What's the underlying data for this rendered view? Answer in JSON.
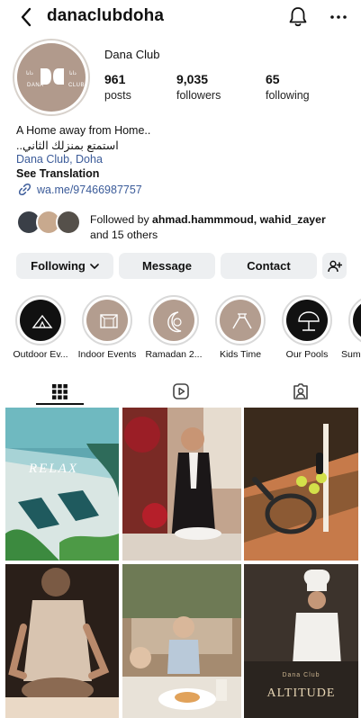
{
  "header": {
    "username": "danaclubdoha"
  },
  "avatar": {
    "text_left": "دانا",
    "text_right": "دانا",
    "text_bottom_left": "DANA",
    "text_bottom_right": "CLUB"
  },
  "profile": {
    "display_name": "Dana Club",
    "stats": [
      {
        "value": "961",
        "label": "posts"
      },
      {
        "value": "9,035",
        "label": "followers"
      },
      {
        "value": "65",
        "label": "following"
      }
    ],
    "bio_line1": "A Home away from Home..",
    "bio_line2": "استمتع بمنزلك الثاني..",
    "location": "Dana Club, Doha",
    "see_translation": "See Translation",
    "link": "wa.me/97466987757"
  },
  "followed_by": {
    "prefix": "Followed by ",
    "names": "ahmad.hammmoud, wahid_zayer",
    "suffix": "and 15 others"
  },
  "actions": {
    "following": "Following",
    "message": "Message",
    "contact": "Contact"
  },
  "highlights": [
    {
      "label": "Outdoor Ev...",
      "color": "#111111"
    },
    {
      "label": "Indoor Events",
      "color": "#b39d8f"
    },
    {
      "label": "Ramadan 2...",
      "color": "#b39d8f"
    },
    {
      "label": "Kids Time",
      "color": "#b39d8f"
    },
    {
      "label": "Our Pools",
      "color": "#111111"
    },
    {
      "label": "Sum",
      "color": "#111111"
    }
  ],
  "posts": [
    {
      "caption": "RELAX",
      "palette": [
        "#5fa7b0",
        "#a7d3d6",
        "#2e6b5a"
      ]
    },
    {
      "caption": "",
      "palette": [
        "#3b1f1a",
        "#8a1d22",
        "#c2a48e"
      ]
    },
    {
      "caption": "",
      "palette": [
        "#3a2a1c",
        "#8c5a34",
        "#c67a4a"
      ]
    },
    {
      "caption": "",
      "palette": [
        "#2a1f19",
        "#8b6a52",
        "#d8c4b0"
      ]
    },
    {
      "caption": "",
      "palette": [
        "#5a4a3a",
        "#a58b70",
        "#d9c8b4"
      ]
    },
    {
      "caption": "ALTITUDE",
      "palette": [
        "#1e1a17",
        "#3c332c",
        "#c9b28e"
      ]
    }
  ],
  "post_subtitle": "Dana Club",
  "colors": {
    "accent_link": "#3b5b99",
    "button_bg": "#edeff1",
    "brand_taupe": "#b19a8c"
  }
}
